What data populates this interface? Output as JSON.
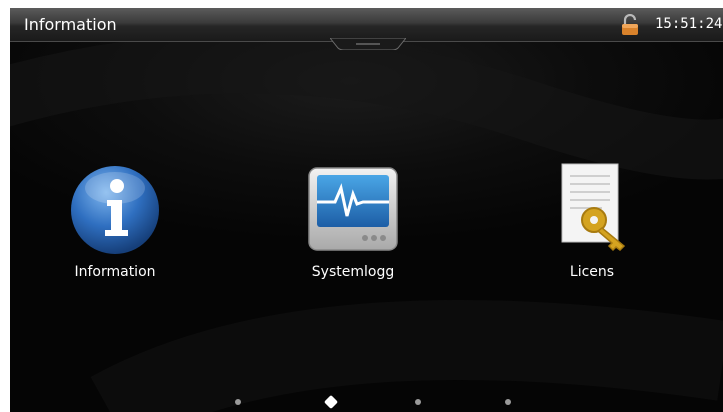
{
  "header": {
    "title": "Information",
    "time": "15:51:24"
  },
  "tiles": [
    {
      "label": "Information",
      "icon": "info-icon"
    },
    {
      "label": "Systemlogg",
      "icon": "monitor-heartbeat-icon"
    },
    {
      "label": "Licens",
      "icon": "license-key-icon"
    }
  ],
  "pager": {
    "count": 4,
    "active_index": 1
  },
  "colors": {
    "topbar": "#2a2a2a",
    "info_blue": "#1f5fb0",
    "monitor_screen": "#2f7fc4",
    "key_gold": "#d4a320",
    "lock_orange": "#d9822b"
  }
}
